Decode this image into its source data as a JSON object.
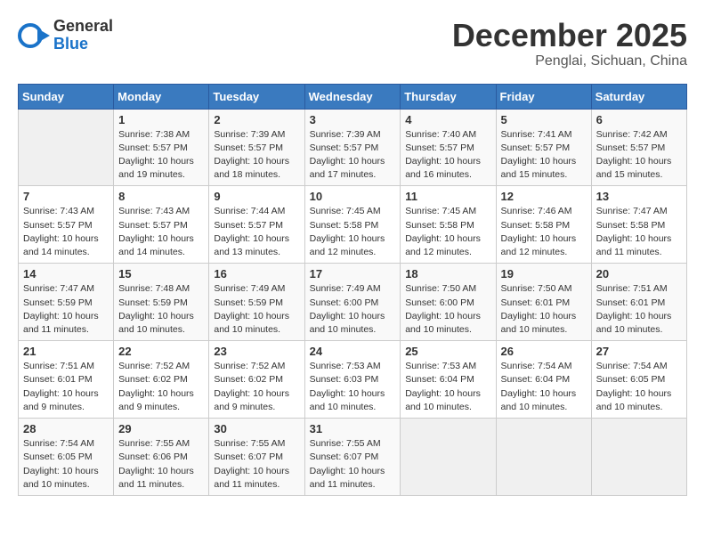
{
  "header": {
    "logo_line1": "General",
    "logo_line2": "Blue",
    "month": "December 2025",
    "location": "Penglai, Sichuan, China"
  },
  "weekdays": [
    "Sunday",
    "Monday",
    "Tuesday",
    "Wednesday",
    "Thursday",
    "Friday",
    "Saturday"
  ],
  "weeks": [
    [
      {
        "day": "",
        "info": ""
      },
      {
        "day": "1",
        "info": "Sunrise: 7:38 AM\nSunset: 5:57 PM\nDaylight: 10 hours\nand 19 minutes."
      },
      {
        "day": "2",
        "info": "Sunrise: 7:39 AM\nSunset: 5:57 PM\nDaylight: 10 hours\nand 18 minutes."
      },
      {
        "day": "3",
        "info": "Sunrise: 7:39 AM\nSunset: 5:57 PM\nDaylight: 10 hours\nand 17 minutes."
      },
      {
        "day": "4",
        "info": "Sunrise: 7:40 AM\nSunset: 5:57 PM\nDaylight: 10 hours\nand 16 minutes."
      },
      {
        "day": "5",
        "info": "Sunrise: 7:41 AM\nSunset: 5:57 PM\nDaylight: 10 hours\nand 15 minutes."
      },
      {
        "day": "6",
        "info": "Sunrise: 7:42 AM\nSunset: 5:57 PM\nDaylight: 10 hours\nand 15 minutes."
      }
    ],
    [
      {
        "day": "7",
        "info": "Sunrise: 7:43 AM\nSunset: 5:57 PM\nDaylight: 10 hours\nand 14 minutes."
      },
      {
        "day": "8",
        "info": "Sunrise: 7:43 AM\nSunset: 5:57 PM\nDaylight: 10 hours\nand 14 minutes."
      },
      {
        "day": "9",
        "info": "Sunrise: 7:44 AM\nSunset: 5:57 PM\nDaylight: 10 hours\nand 13 minutes."
      },
      {
        "day": "10",
        "info": "Sunrise: 7:45 AM\nSunset: 5:58 PM\nDaylight: 10 hours\nand 12 minutes."
      },
      {
        "day": "11",
        "info": "Sunrise: 7:45 AM\nSunset: 5:58 PM\nDaylight: 10 hours\nand 12 minutes."
      },
      {
        "day": "12",
        "info": "Sunrise: 7:46 AM\nSunset: 5:58 PM\nDaylight: 10 hours\nand 12 minutes."
      },
      {
        "day": "13",
        "info": "Sunrise: 7:47 AM\nSunset: 5:58 PM\nDaylight: 10 hours\nand 11 minutes."
      }
    ],
    [
      {
        "day": "14",
        "info": "Sunrise: 7:47 AM\nSunset: 5:59 PM\nDaylight: 10 hours\nand 11 minutes."
      },
      {
        "day": "15",
        "info": "Sunrise: 7:48 AM\nSunset: 5:59 PM\nDaylight: 10 hours\nand 10 minutes."
      },
      {
        "day": "16",
        "info": "Sunrise: 7:49 AM\nSunset: 5:59 PM\nDaylight: 10 hours\nand 10 minutes."
      },
      {
        "day": "17",
        "info": "Sunrise: 7:49 AM\nSunset: 6:00 PM\nDaylight: 10 hours\nand 10 minutes."
      },
      {
        "day": "18",
        "info": "Sunrise: 7:50 AM\nSunset: 6:00 PM\nDaylight: 10 hours\nand 10 minutes."
      },
      {
        "day": "19",
        "info": "Sunrise: 7:50 AM\nSunset: 6:01 PM\nDaylight: 10 hours\nand 10 minutes."
      },
      {
        "day": "20",
        "info": "Sunrise: 7:51 AM\nSunset: 6:01 PM\nDaylight: 10 hours\nand 10 minutes."
      }
    ],
    [
      {
        "day": "21",
        "info": "Sunrise: 7:51 AM\nSunset: 6:01 PM\nDaylight: 10 hours\nand 9 minutes."
      },
      {
        "day": "22",
        "info": "Sunrise: 7:52 AM\nSunset: 6:02 PM\nDaylight: 10 hours\nand 9 minutes."
      },
      {
        "day": "23",
        "info": "Sunrise: 7:52 AM\nSunset: 6:02 PM\nDaylight: 10 hours\nand 9 minutes."
      },
      {
        "day": "24",
        "info": "Sunrise: 7:53 AM\nSunset: 6:03 PM\nDaylight: 10 hours\nand 10 minutes."
      },
      {
        "day": "25",
        "info": "Sunrise: 7:53 AM\nSunset: 6:04 PM\nDaylight: 10 hours\nand 10 minutes."
      },
      {
        "day": "26",
        "info": "Sunrise: 7:54 AM\nSunset: 6:04 PM\nDaylight: 10 hours\nand 10 minutes."
      },
      {
        "day": "27",
        "info": "Sunrise: 7:54 AM\nSunset: 6:05 PM\nDaylight: 10 hours\nand 10 minutes."
      }
    ],
    [
      {
        "day": "28",
        "info": "Sunrise: 7:54 AM\nSunset: 6:05 PM\nDaylight: 10 hours\nand 10 minutes."
      },
      {
        "day": "29",
        "info": "Sunrise: 7:55 AM\nSunset: 6:06 PM\nDaylight: 10 hours\nand 11 minutes."
      },
      {
        "day": "30",
        "info": "Sunrise: 7:55 AM\nSunset: 6:07 PM\nDaylight: 10 hours\nand 11 minutes."
      },
      {
        "day": "31",
        "info": "Sunrise: 7:55 AM\nSunset: 6:07 PM\nDaylight: 10 hours\nand 11 minutes."
      },
      {
        "day": "",
        "info": ""
      },
      {
        "day": "",
        "info": ""
      },
      {
        "day": "",
        "info": ""
      }
    ]
  ]
}
